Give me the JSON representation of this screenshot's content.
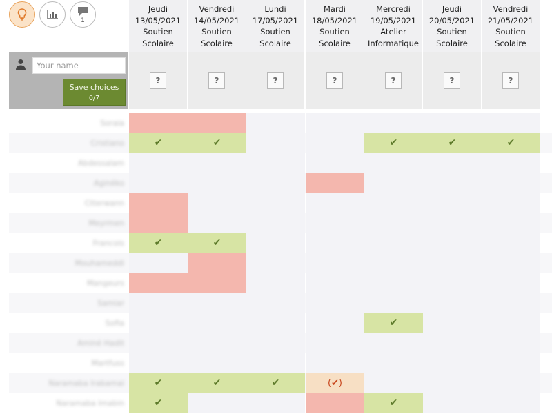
{
  "toolbar": {
    "buttons": [
      {
        "icon": "lightbulb-icon",
        "active": true
      },
      {
        "icon": "bar-chart-icon",
        "active": false
      },
      {
        "icon": "comment-icon",
        "count": "1",
        "active": false
      }
    ]
  },
  "columns": [
    {
      "day": "Jeudi",
      "date": "13/05/2021",
      "title1": "Soutien",
      "title2": "Scolaire"
    },
    {
      "day": "Vendredi",
      "date": "14/05/2021",
      "title1": "Soutien",
      "title2": "Scolaire"
    },
    {
      "day": "Lundi",
      "date": "17/05/2021",
      "title1": "Soutien",
      "title2": "Scolaire"
    },
    {
      "day": "Mardi",
      "date": "18/05/2021",
      "title1": "Soutien",
      "title2": "Scolaire"
    },
    {
      "day": "Mercredi",
      "date": "19/05/2021",
      "title1": "Atelier",
      "title2": "Informatique"
    },
    {
      "day": "Jeudi",
      "date": "20/05/2021",
      "title1": "Soutien",
      "title2": "Scolaire"
    },
    {
      "day": "Vendredi",
      "date": "21/05/2021",
      "title1": "Soutien",
      "title2": "Scolaire"
    }
  ],
  "form": {
    "name_placeholder": "Your name",
    "save_label": "Save choices",
    "save_count": "0/7",
    "unknown_mark": "?"
  },
  "colors": {
    "yes": "#d7e4a4",
    "no": "#f4b7ae",
    "maybe": "#f7dfc4",
    "accent": "#6c8a31"
  },
  "legend": {
    "yes": "✔",
    "maybe": "(✔)"
  },
  "participants": [
    {
      "name": "Soraia",
      "votes": [
        "no",
        "no",
        "",
        "",
        "",
        "",
        ""
      ]
    },
    {
      "name": "Cristiano",
      "votes": [
        "yes",
        "yes",
        "",
        "",
        "yes",
        "yes",
        "yes"
      ]
    },
    {
      "name": "Abdessalam",
      "votes": [
        "",
        "",
        "",
        "",
        "",
        "",
        ""
      ]
    },
    {
      "name": "Aginéko",
      "votes": [
        "",
        "",
        "",
        "no",
        "",
        "",
        ""
      ]
    },
    {
      "name": "Ctterwann",
      "votes": [
        "no",
        "",
        "",
        "",
        "",
        "",
        ""
      ]
    },
    {
      "name": "Meyrmen",
      "votes": [
        "no",
        "",
        "",
        "",
        "",
        "",
        ""
      ]
    },
    {
      "name": "Francois",
      "votes": [
        "yes",
        "yes",
        "",
        "",
        "",
        "",
        ""
      ]
    },
    {
      "name": "Mouhameddi",
      "votes": [
        "",
        "no",
        "",
        "",
        "",
        "",
        ""
      ]
    },
    {
      "name": "Mangeurs",
      "votes": [
        "no",
        "no",
        "",
        "",
        "",
        "",
        ""
      ]
    },
    {
      "name": "Samiar",
      "votes": [
        "",
        "",
        "",
        "",
        "",
        "",
        ""
      ]
    },
    {
      "name": "Sofia",
      "votes": [
        "",
        "",
        "",
        "",
        "yes",
        "",
        ""
      ]
    },
    {
      "name": "Aminé Hadit",
      "votes": [
        "",
        "",
        "",
        "",
        "",
        "",
        ""
      ]
    },
    {
      "name": "Martfuss",
      "votes": [
        "",
        "",
        "",
        "",
        "",
        "",
        ""
      ]
    },
    {
      "name": "Naramaba Irabamai",
      "votes": [
        "yes",
        "yes",
        "yes",
        "maybe",
        "",
        "",
        ""
      ]
    },
    {
      "name": "Naramaba Imabin",
      "votes": [
        "yes",
        "",
        "",
        "no",
        "yes",
        "",
        ""
      ]
    }
  ]
}
